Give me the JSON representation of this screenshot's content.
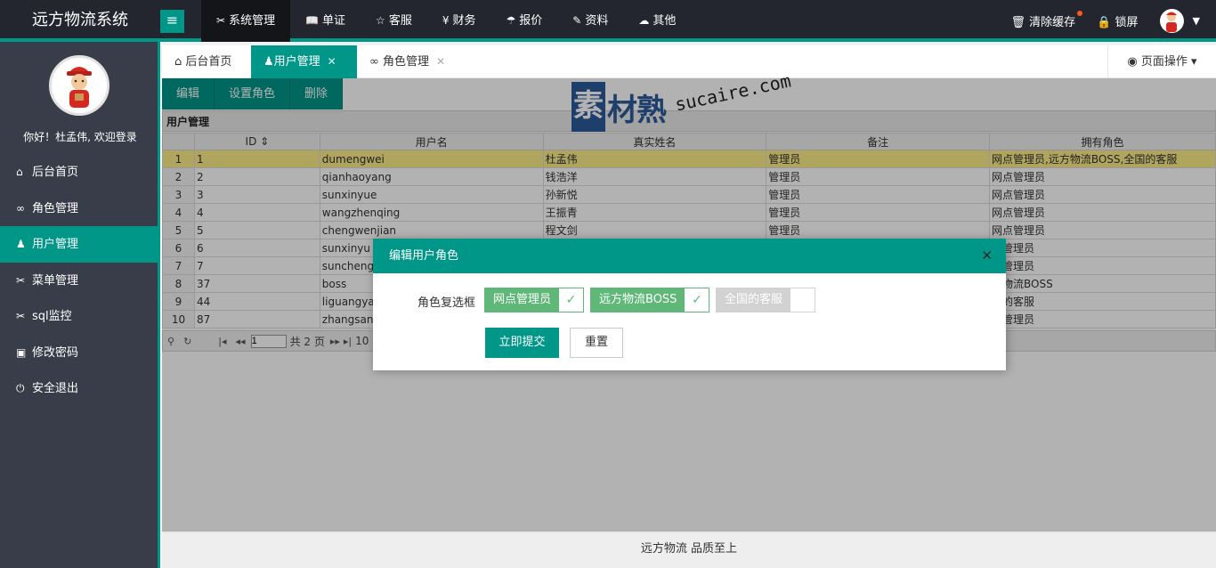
{
  "app": {
    "title": "远方物流系统"
  },
  "topnav": [
    {
      "label": "系统管理",
      "icon": "✂",
      "active": true
    },
    {
      "label": "单证",
      "icon": "📖"
    },
    {
      "label": "客服",
      "icon": "☆"
    },
    {
      "label": "财务",
      "icon": "¥"
    },
    {
      "label": "报价",
      "icon": "☂"
    },
    {
      "label": "资料",
      "icon": "✎"
    },
    {
      "label": "其他",
      "icon": "☁"
    }
  ],
  "topright": {
    "clear_cache": "清除缓存",
    "lock": "锁屏"
  },
  "sidebar": {
    "welcome": "你好！杜孟伟, 欢迎登录",
    "items": [
      {
        "label": "后台首页",
        "icon": "⌂"
      },
      {
        "label": "角色管理",
        "icon": "∞"
      },
      {
        "label": "用户管理",
        "icon": "♟",
        "active": true
      },
      {
        "label": "菜单管理",
        "icon": "✂"
      },
      {
        "label": "sql监控",
        "icon": "✂"
      },
      {
        "label": "修改密码",
        "icon": "▣"
      },
      {
        "label": "安全退出",
        "icon": "⏻"
      }
    ]
  },
  "tabs": {
    "home": "后台首页",
    "users": "用户管理",
    "roles": "角色管理",
    "page_ops": "页面操作"
  },
  "toolbar": {
    "edit": "编辑",
    "set_role": "设置角色",
    "delete": "删除"
  },
  "grid": {
    "title": "用户管理",
    "columns": [
      "ID",
      "用户名",
      "真实姓名",
      "备注",
      "拥有角色"
    ],
    "rows": [
      [
        "1",
        "1",
        "dumengwei",
        "杜孟伟",
        "管理员",
        "网点管理员,远方物流BOSS,全国的客服"
      ],
      [
        "2",
        "2",
        "qianhaoyang",
        "钱浩洋",
        "管理员",
        "网点管理员"
      ],
      [
        "3",
        "3",
        "sunxinyue",
        "孙新悦",
        "管理员",
        "网点管理员"
      ],
      [
        "4",
        "4",
        "wangzhenqing",
        "王振青",
        "管理员",
        "网点管理员"
      ],
      [
        "5",
        "5",
        "chengwenjian",
        "程文剑",
        "管理员",
        "网点管理员"
      ],
      [
        "6",
        "6",
        "sunxinyu",
        "",
        "",
        "点管理员"
      ],
      [
        "7",
        "7",
        "sunchengc",
        "",
        "",
        "点管理员"
      ],
      [
        "8",
        "37",
        "boss",
        "",
        "",
        "方物流BOSS"
      ],
      [
        "9",
        "44",
        "liguangyao",
        "",
        "",
        "国的客服"
      ],
      [
        "10",
        "87",
        "zhangsan",
        "",
        "",
        "点管理员"
      ]
    ],
    "pager": {
      "page_value": "1",
      "total": "共 2 页",
      "size": "10"
    }
  },
  "watermark": {
    "brand": "素材熟",
    "url": "sucaire.com"
  },
  "dialog": {
    "title": "编辑用户角色",
    "field_label": "角色复选框",
    "options": [
      {
        "label": "网点管理员",
        "checked": true
      },
      {
        "label": "远方物流BOSS",
        "checked": true
      },
      {
        "label": "全国的客服",
        "checked": false
      }
    ],
    "submit": "立即提交",
    "reset": "重置"
  },
  "footer": "远方物流 品质至上"
}
